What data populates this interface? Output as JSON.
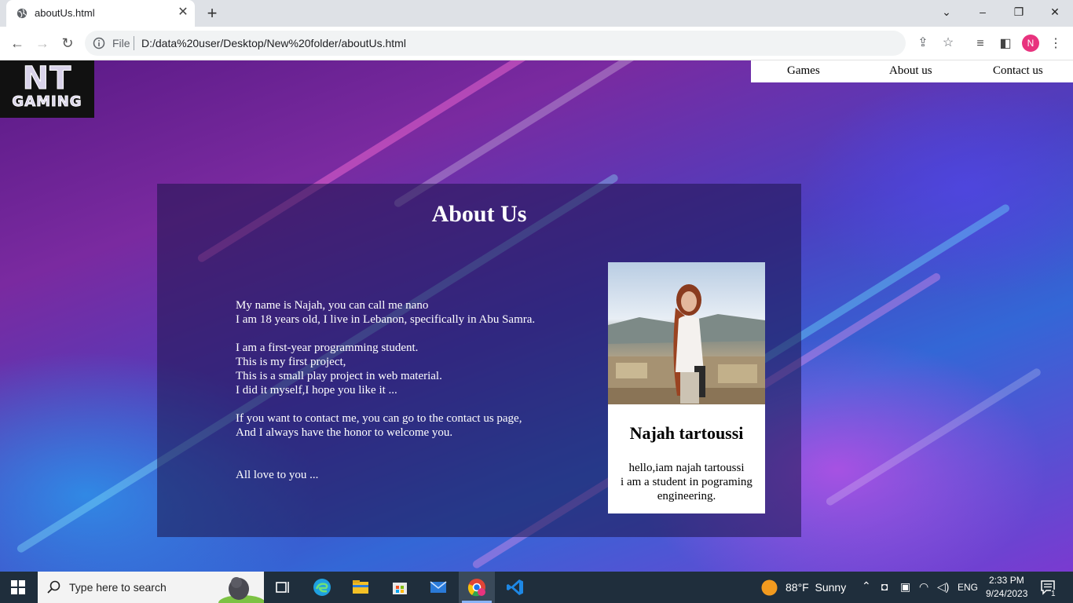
{
  "browser": {
    "tab_title": "aboutUs.html",
    "omnibox_prefix": "File",
    "url": "D:/data%20user/Desktop/New%20folder/aboutUs.html",
    "profile_initial": "N"
  },
  "site": {
    "logo_line1": "NT",
    "logo_line2": "GAMING",
    "nav": [
      "Games",
      "About us",
      "Contact us"
    ]
  },
  "about": {
    "title": "About Us",
    "lines": [
      "My name is Najah, you can call me nano",
      "I am 18 years old, I live in Lebanon, specifically in Abu Samra.",
      "I am a first-year programming student.",
      "This is my first project,",
      "This is a small play project in web material.",
      "I did it myself,I hope you like it ...",
      "If you want to contact me, you can go to the contact us page,",
      "And I always have the honor to welcome you.",
      "All love to you ..."
    ]
  },
  "card": {
    "name": "Najah tartoussi",
    "desc_line1": "hello,iam najah tartoussi",
    "desc_line2": "i am a student in pograming engineering."
  },
  "taskbar": {
    "search_placeholder": "Type here to search",
    "weather": "88°F  Sunny",
    "lang": "ENG",
    "time": "2:33 PM",
    "date": "9/24/2023",
    "notif_count": "1"
  },
  "colors": {
    "accent_avatar": "#e8337e",
    "taskbar_bg": "#1f2e3c",
    "panel_bg": "rgba(28,20,74,0.55)"
  }
}
